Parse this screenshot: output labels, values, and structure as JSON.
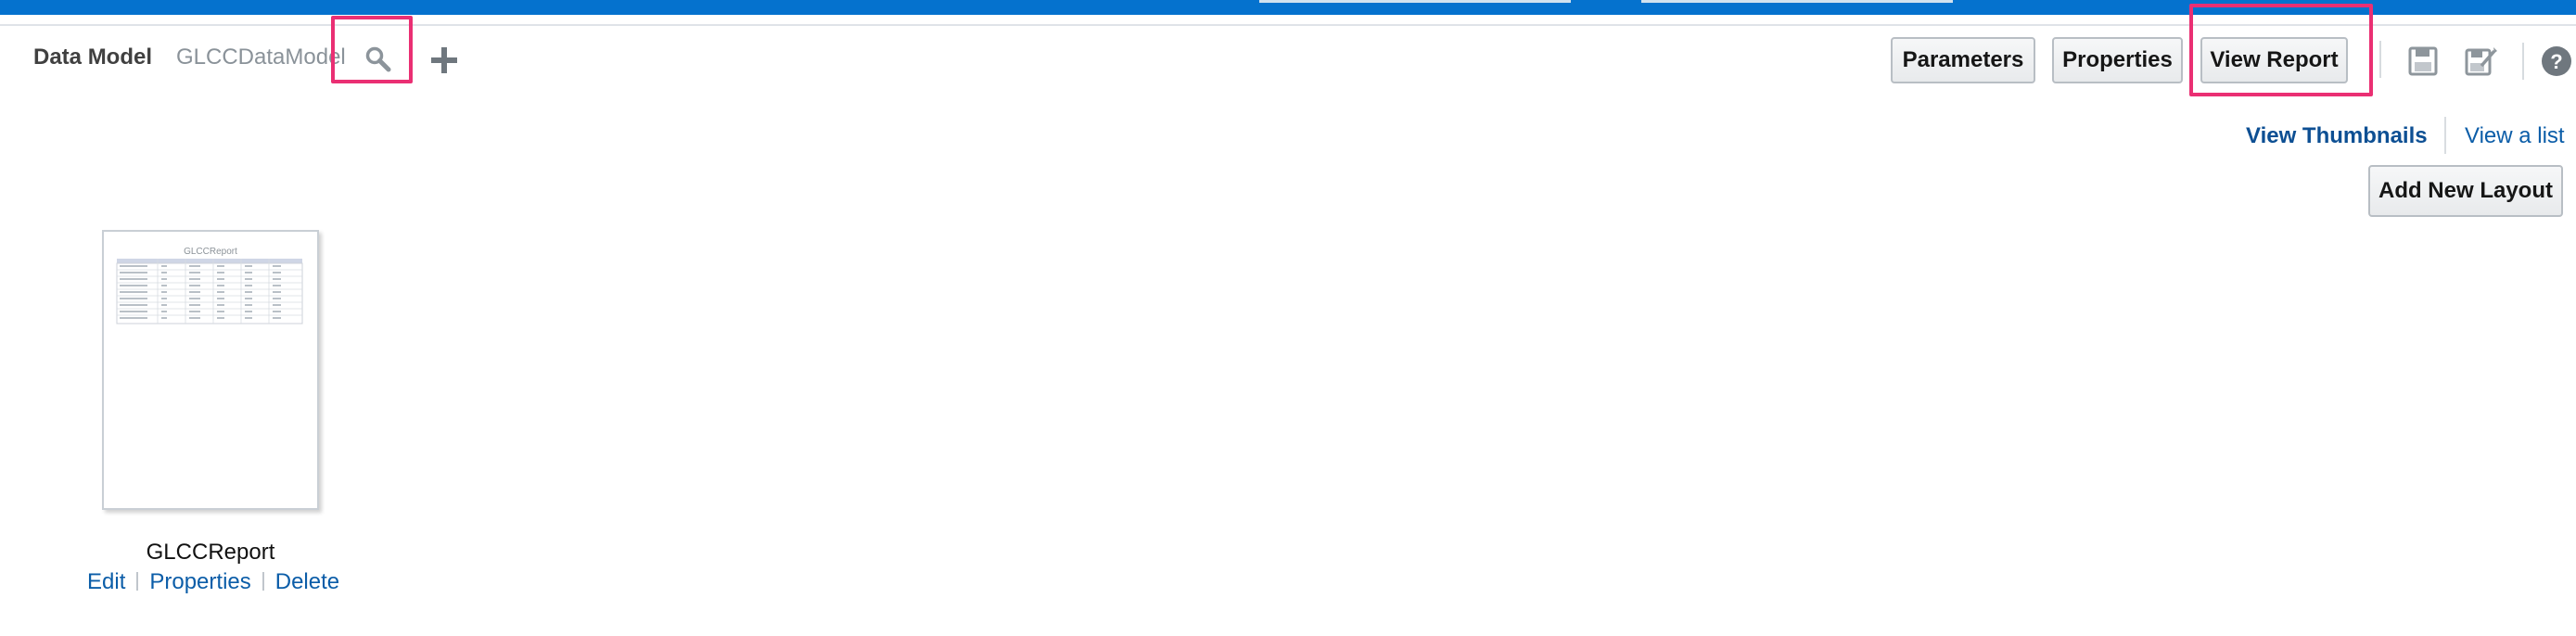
{
  "header": {
    "data_model_label": "Data Model",
    "data_model_name": "GLCCDataModel",
    "search_icon": "search-icon",
    "add_icon": "plus-icon"
  },
  "toolbar": {
    "parameters_label": "Parameters",
    "properties_label": "Properties",
    "view_report_label": "View Report",
    "save_icon": "save-icon",
    "save_as_icon": "save-as-icon",
    "help_icon": "help-icon"
  },
  "view_switch": {
    "thumbnails_label": "View Thumbnails",
    "list_label": "View a list"
  },
  "add_new_layout_label": "Add New Layout",
  "layouts": [
    {
      "name": "GLCCReport",
      "thumbnail_title": "GLCCReport",
      "actions": [
        "Edit",
        "Properties",
        "Delete"
      ]
    }
  ],
  "colors": {
    "top_bar": "#0572ce",
    "highlight": "#ea2f73",
    "link": "#0b5da8"
  }
}
